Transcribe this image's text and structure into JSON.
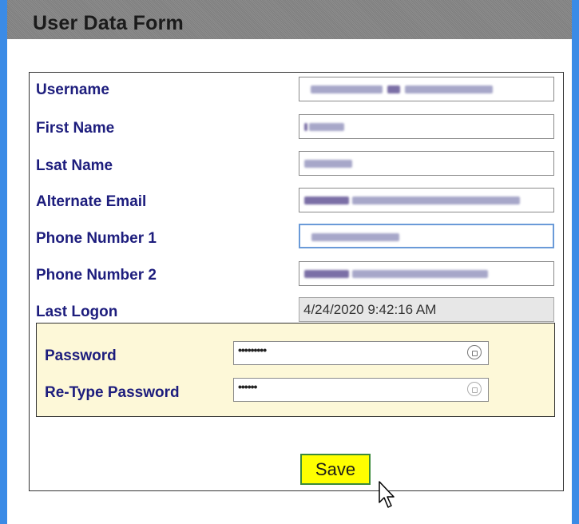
{
  "form": {
    "title": "User Data Form",
    "fields": [
      {
        "label": "Username"
      },
      {
        "label": "First Name"
      },
      {
        "label": "Lsat Name"
      },
      {
        "label": "Alternate Email"
      },
      {
        "label": "Phone Number 1"
      },
      {
        "label": "Phone Number 2"
      },
      {
        "label": "Last Logon",
        "value": "4/24/2020 9:42:16 AM"
      }
    ],
    "password": {
      "label": "Password",
      "masked": "•••••••••"
    },
    "retype_password": {
      "label": "Re-Type Password",
      "masked": "••••••"
    },
    "save_label": "Save",
    "accent_colors": {
      "frame": "#3b8be6",
      "label": "#1d1d7d",
      "password_bg": "#fdf8d8",
      "save_bg": "#ffff00"
    }
  }
}
